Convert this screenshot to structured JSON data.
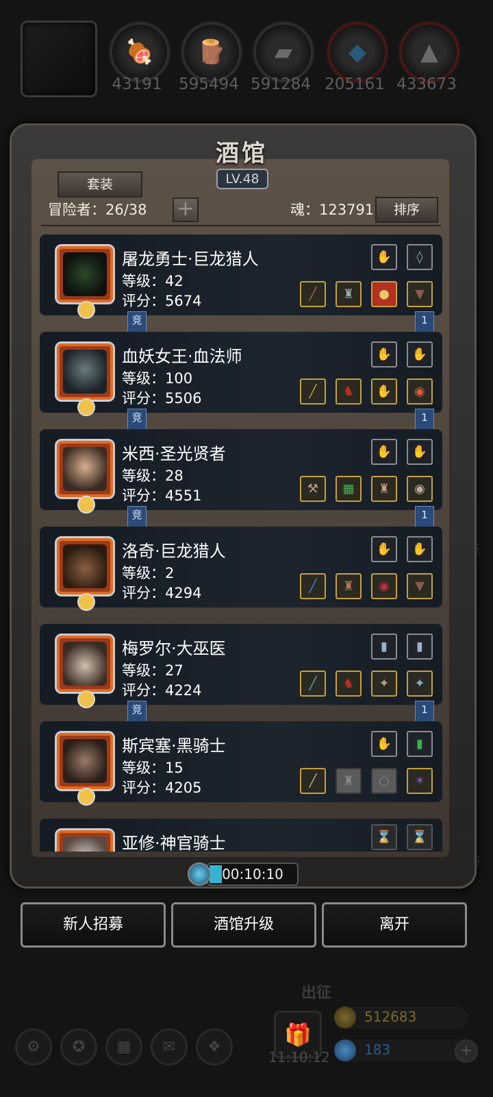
{
  "resources": [
    {
      "icon": "meat-icon",
      "value": "43191"
    },
    {
      "icon": "wood-icon",
      "value": "595494"
    },
    {
      "icon": "iron-icon",
      "value": "591284"
    },
    {
      "icon": "crystal-icon",
      "value": "205161"
    },
    {
      "icon": "stone-icon",
      "value": "433673"
    }
  ],
  "tavern": {
    "title": "酒馆",
    "level": "LV.48",
    "suit_button": "套装",
    "adventurers_label": "冒险者：26/38",
    "add_icon": "plus-icon",
    "soul_label": "魂：123791",
    "sort_button": "排序"
  },
  "heroes": [
    {
      "name": "屠龙勇士·巨龙猎人",
      "level": "等级：42",
      "score": "评分：5674",
      "badge_left": "竞",
      "badge_right": "1"
    },
    {
      "name": "血妖女王·血法师",
      "level": "等级：100",
      "score": "评分：5506",
      "badge_left": "竞",
      "badge_right": "1"
    },
    {
      "name": "米西·圣光贤者",
      "level": "等级：28",
      "score": "评分：4551",
      "badge_left": "竞",
      "badge_right": "1"
    },
    {
      "name": "洛奇·巨龙猎人",
      "level": "等级：2",
      "score": "评分：4294",
      "badge_left": "",
      "badge_right": ""
    },
    {
      "name": "梅罗尔·大巫医",
      "level": "等级：27",
      "score": "评分：4224",
      "badge_left": "竞",
      "badge_right": "1"
    },
    {
      "name": "斯宾塞·黑骑士",
      "level": "等级：15",
      "score": "评分：4205",
      "badge_left": "",
      "badge_right": ""
    },
    {
      "name": "亚修·神官骑士",
      "level": "",
      "score": "",
      "badge_left": "",
      "badge_right": ""
    }
  ],
  "timer": "00:10:10",
  "buttons": {
    "recruit": "新人招募",
    "upgrade": "酒馆升级",
    "leave": "离开"
  },
  "bottom": {
    "expedition": "出征",
    "clock": "11:10:12",
    "gold": "512683",
    "gems": "183"
  },
  "sidebar_fragments": [
    "技",
    "市"
  ],
  "colors": {
    "gold_text": "#7a6a2a",
    "gem_text": "#2a5a8a",
    "accent_border": "#c8a03a"
  }
}
